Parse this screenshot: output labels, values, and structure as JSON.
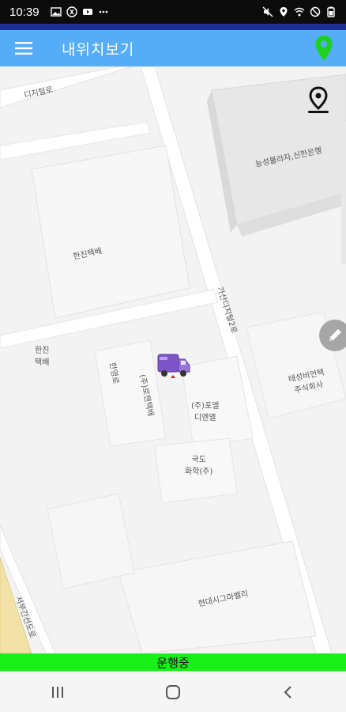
{
  "status_bar": {
    "time": "10:39",
    "left_icons": [
      "gallery-icon",
      "app-icon",
      "youtube-icon",
      "more-icon"
    ],
    "right_icons": [
      "mute-icon",
      "location-icon",
      "wifi-icon",
      "dnd-icon",
      "battery-icon"
    ]
  },
  "app_bar": {
    "title": "내위치보기",
    "menu_icon": "hamburger-menu-icon",
    "location_icon": "map-pin-icon",
    "location_icon_color": "#1fd11f"
  },
  "map": {
    "labels": [
      "디지털로",
      "한진택배",
      "가산디지털2로",
      "한진\n택배",
      "(주)로젠택배",
      "(주)포엘\n디엔엘",
      "국도\n화학(주)",
      "현대시그마벨리",
      "능성물라자,신한은행",
      "태성비언택\n주식회사",
      "서부간선도로",
      "한영로"
    ]
  },
  "banner": {
    "text": "운행중",
    "color": "#19f019"
  },
  "nav_bar": {
    "recent": "recent-apps-icon",
    "home": "home-icon",
    "back": "back-icon"
  }
}
